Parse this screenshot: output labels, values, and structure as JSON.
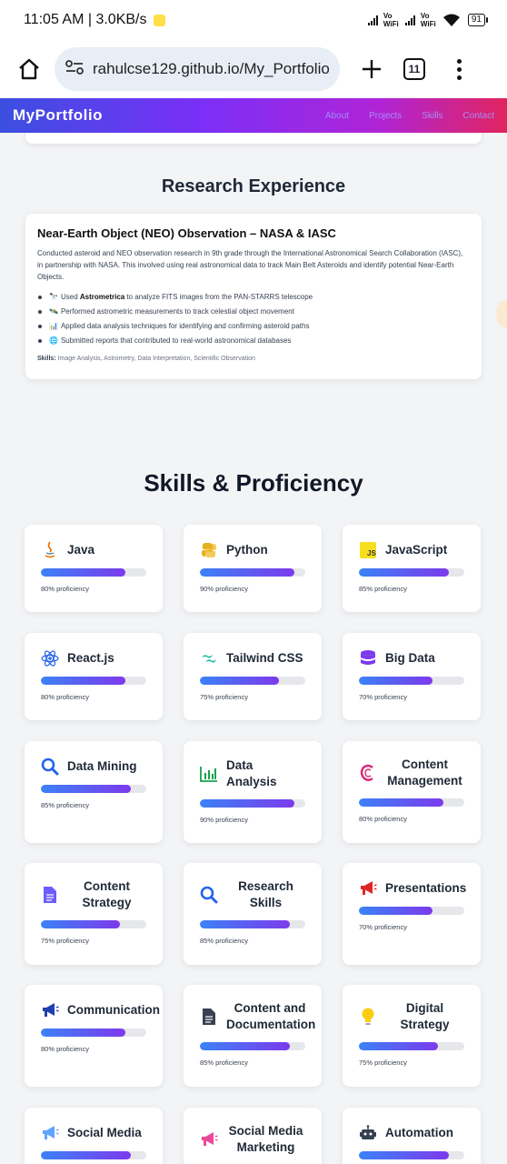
{
  "status_bar": {
    "time_speed": "11:05 AM | 3.0KB/s",
    "vowifi_1": "Vo WiFi",
    "vowifi_2": "Vo WiFi",
    "battery": "91"
  },
  "browser": {
    "url": "rahulcse129.github.io/My_Portfolio/",
    "tab_count": "11"
  },
  "site_nav": {
    "brand": "MyPortfolio",
    "links": [
      "About",
      "Projects",
      "Skills",
      "Contact"
    ]
  },
  "research": {
    "heading": "Research Experience",
    "card": {
      "title": "Near-Earth Object (NEO) Observation – NASA & IASC",
      "description": "Conducted asteroid and NEO observation research in 9th grade through the International Astronomical Search Collaboration (IASC), in partnership with NASA. This involved using real astronomical data to track Main Belt Asteroids and identify potential Near-Earth Objects.",
      "bullets": [
        {
          "emoji": "🔭",
          "pre": "Used ",
          "bold": "Astrometrica",
          "post": " to analyze FITS images from the PAN-STARRS telescope"
        },
        {
          "emoji": "🛰️",
          "pre": "Performed astrometric measurements to track celestial object movement",
          "bold": "",
          "post": ""
        },
        {
          "emoji": "📊",
          "pre": "Applied data analysis techniques for identifying and confirming asteroid paths",
          "bold": "",
          "post": ""
        },
        {
          "emoji": "🌐",
          "pre": "Submitted reports that contributed to real-world astronomical databases",
          "bold": "",
          "post": ""
        }
      ],
      "skills_label": "Skills:",
      "skills_text": " Image Analysis, Astrometry, Data Interpretation, Scientific Observation"
    }
  },
  "skills": {
    "heading": "Skills & Proficiency",
    "colors": {
      "bar_start": "#3b82f6",
      "bar_end": "#7c3aed"
    },
    "items": [
      {
        "name": "Java",
        "icon": "java-icon",
        "level": 80,
        "label": "80% proficiency"
      },
      {
        "name": "Python",
        "icon": "python-icon",
        "level": 90,
        "label": "90% proficiency"
      },
      {
        "name": "JavaScript",
        "icon": "javascript-icon",
        "level": 85,
        "label": "85% proficiency"
      },
      {
        "name": "React.js",
        "icon": "react-icon",
        "level": 80,
        "label": "80% proficiency"
      },
      {
        "name": "Tailwind CSS",
        "icon": "tailwind-icon",
        "level": 75,
        "label": "75% proficiency"
      },
      {
        "name": "Big Data",
        "icon": "database-icon",
        "level": 70,
        "label": "70% proficiency"
      },
      {
        "name": "Data Mining",
        "icon": "search-icon",
        "level": 85,
        "label": "85% proficiency"
      },
      {
        "name": "Data Analysis",
        "icon": "bar-chart-icon",
        "level": 90,
        "label": "90% proficiency"
      },
      {
        "name": "Content Management",
        "icon": "cms-icon",
        "level": 80,
        "label": "80% proficiency"
      },
      {
        "name": "Content Strategy",
        "icon": "document-icon",
        "level": 75,
        "label": "75% proficiency"
      },
      {
        "name": "Research Skills",
        "icon": "search-icon",
        "level": 85,
        "label": "85% proficiency"
      },
      {
        "name": "Presentations",
        "icon": "megaphone-icon",
        "level": 70,
        "label": "70% proficiency"
      },
      {
        "name": "Communication",
        "icon": "megaphone-icon",
        "level": 80,
        "label": "80% proficiency"
      },
      {
        "name": "Content and Documentation",
        "icon": "file-icon",
        "level": 85,
        "label": "85% proficiency"
      },
      {
        "name": "Digital Strategy",
        "icon": "lightbulb-icon",
        "level": 75,
        "label": "75% proficiency"
      },
      {
        "name": "Social Media",
        "icon": "megaphone-icon",
        "level": 85,
        "label": ""
      },
      {
        "name": "Social Media Marketing",
        "icon": "megaphone-icon",
        "level": 80,
        "label": ""
      },
      {
        "name": "Automation",
        "icon": "robot-icon",
        "level": 85,
        "label": ""
      }
    ]
  }
}
